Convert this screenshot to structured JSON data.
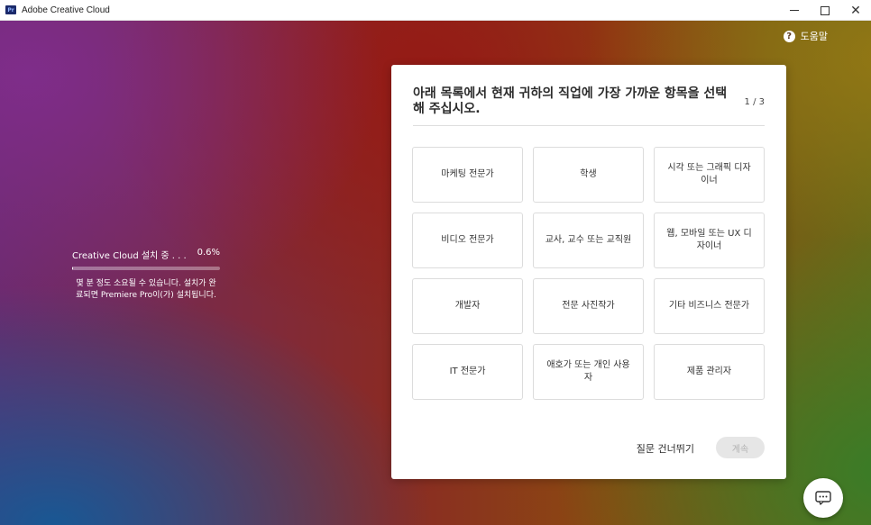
{
  "window": {
    "title": "Adobe Creative Cloud",
    "app_icon_text": "Pr",
    "controls": {
      "minimize": "minimize",
      "maximize": "maximize",
      "close": "✕"
    }
  },
  "help": {
    "icon": "question-circle-icon",
    "label": "도움말"
  },
  "progress": {
    "status": "Creative Cloud 설치 중 . . .",
    "percent_text": "0.6%",
    "percent_value": 0.006,
    "note_line1": "몇 분 정도 소요될 수 있습니다. 설치가 완",
    "note_line2": "료되면 Premiere Pro이(가) 설치됩니다."
  },
  "survey": {
    "question": "아래 목록에서 현재 귀하의 직업에 가장 가까운 항목을 선택해 주십시오.",
    "step": "1 / 3",
    "options": [
      "마케팅 전문가",
      "학생",
      "시각 또는 그래픽 디자이너",
      "비디오 전문가",
      "교사, 교수 또는 교직원",
      "웹, 모바일 또는 UX 디자이너",
      "개발자",
      "전문 사진작가",
      "기타 비즈니스 전문가",
      "IT 전문가",
      "애호가 또는 개인 사용자",
      "제품 관리자"
    ],
    "skip_label": "질문 건너뛰기",
    "continue_label": "계속"
  },
  "chat": {
    "icon": "chat-bubble-icon"
  },
  "colors": {
    "accent_disabled_bg": "#e6e6e6",
    "accent_disabled_text": "#b3b3b3",
    "card_bg": "#ffffff"
  }
}
